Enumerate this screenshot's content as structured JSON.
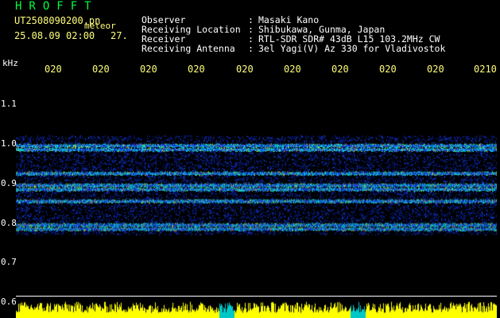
{
  "header": {
    "title": "HROFFT",
    "filename": "UT2508090200.pn",
    "meteor_label": "meteor",
    "datetime": "25.08.09 02:00",
    "number": "27."
  },
  "info": [
    {
      "key": "Observer",
      "value": "Masaki Kano"
    },
    {
      "key": "Receiving Location",
      "value": "Shibukawa, Gunma, Japan"
    },
    {
      "key": "Receiver",
      "value": "RTL-SDR SDR# 43dB L15 103.2MHz CW"
    },
    {
      "key": "Receiving Antenna",
      "value": "3el Yagi(V) Az 330 for Vladivostok"
    }
  ],
  "chart_data": {
    "type": "heatmap",
    "ylabel": "kHz",
    "y_ticks": [
      "1.1",
      "1.0",
      "0.9",
      "0.8",
      "0.7",
      "0.6"
    ],
    "y_range": [
      0.6,
      1.1
    ],
    "x_ticks": [
      "020",
      "020",
      "020",
      "020",
      "020",
      "020",
      "020",
      "020",
      "020",
      "0210"
    ],
    "signal_bands_khz": [
      0.99,
      0.98,
      0.92,
      0.89,
      0.88,
      0.85,
      0.79,
      0.78
    ],
    "colors": {
      "background": "#000000",
      "noise": "#1030d8",
      "mid": "#00ffff",
      "strong": "#ffff00",
      "peak": "#ff3030",
      "amplitude_trace": "#ffff00"
    }
  }
}
